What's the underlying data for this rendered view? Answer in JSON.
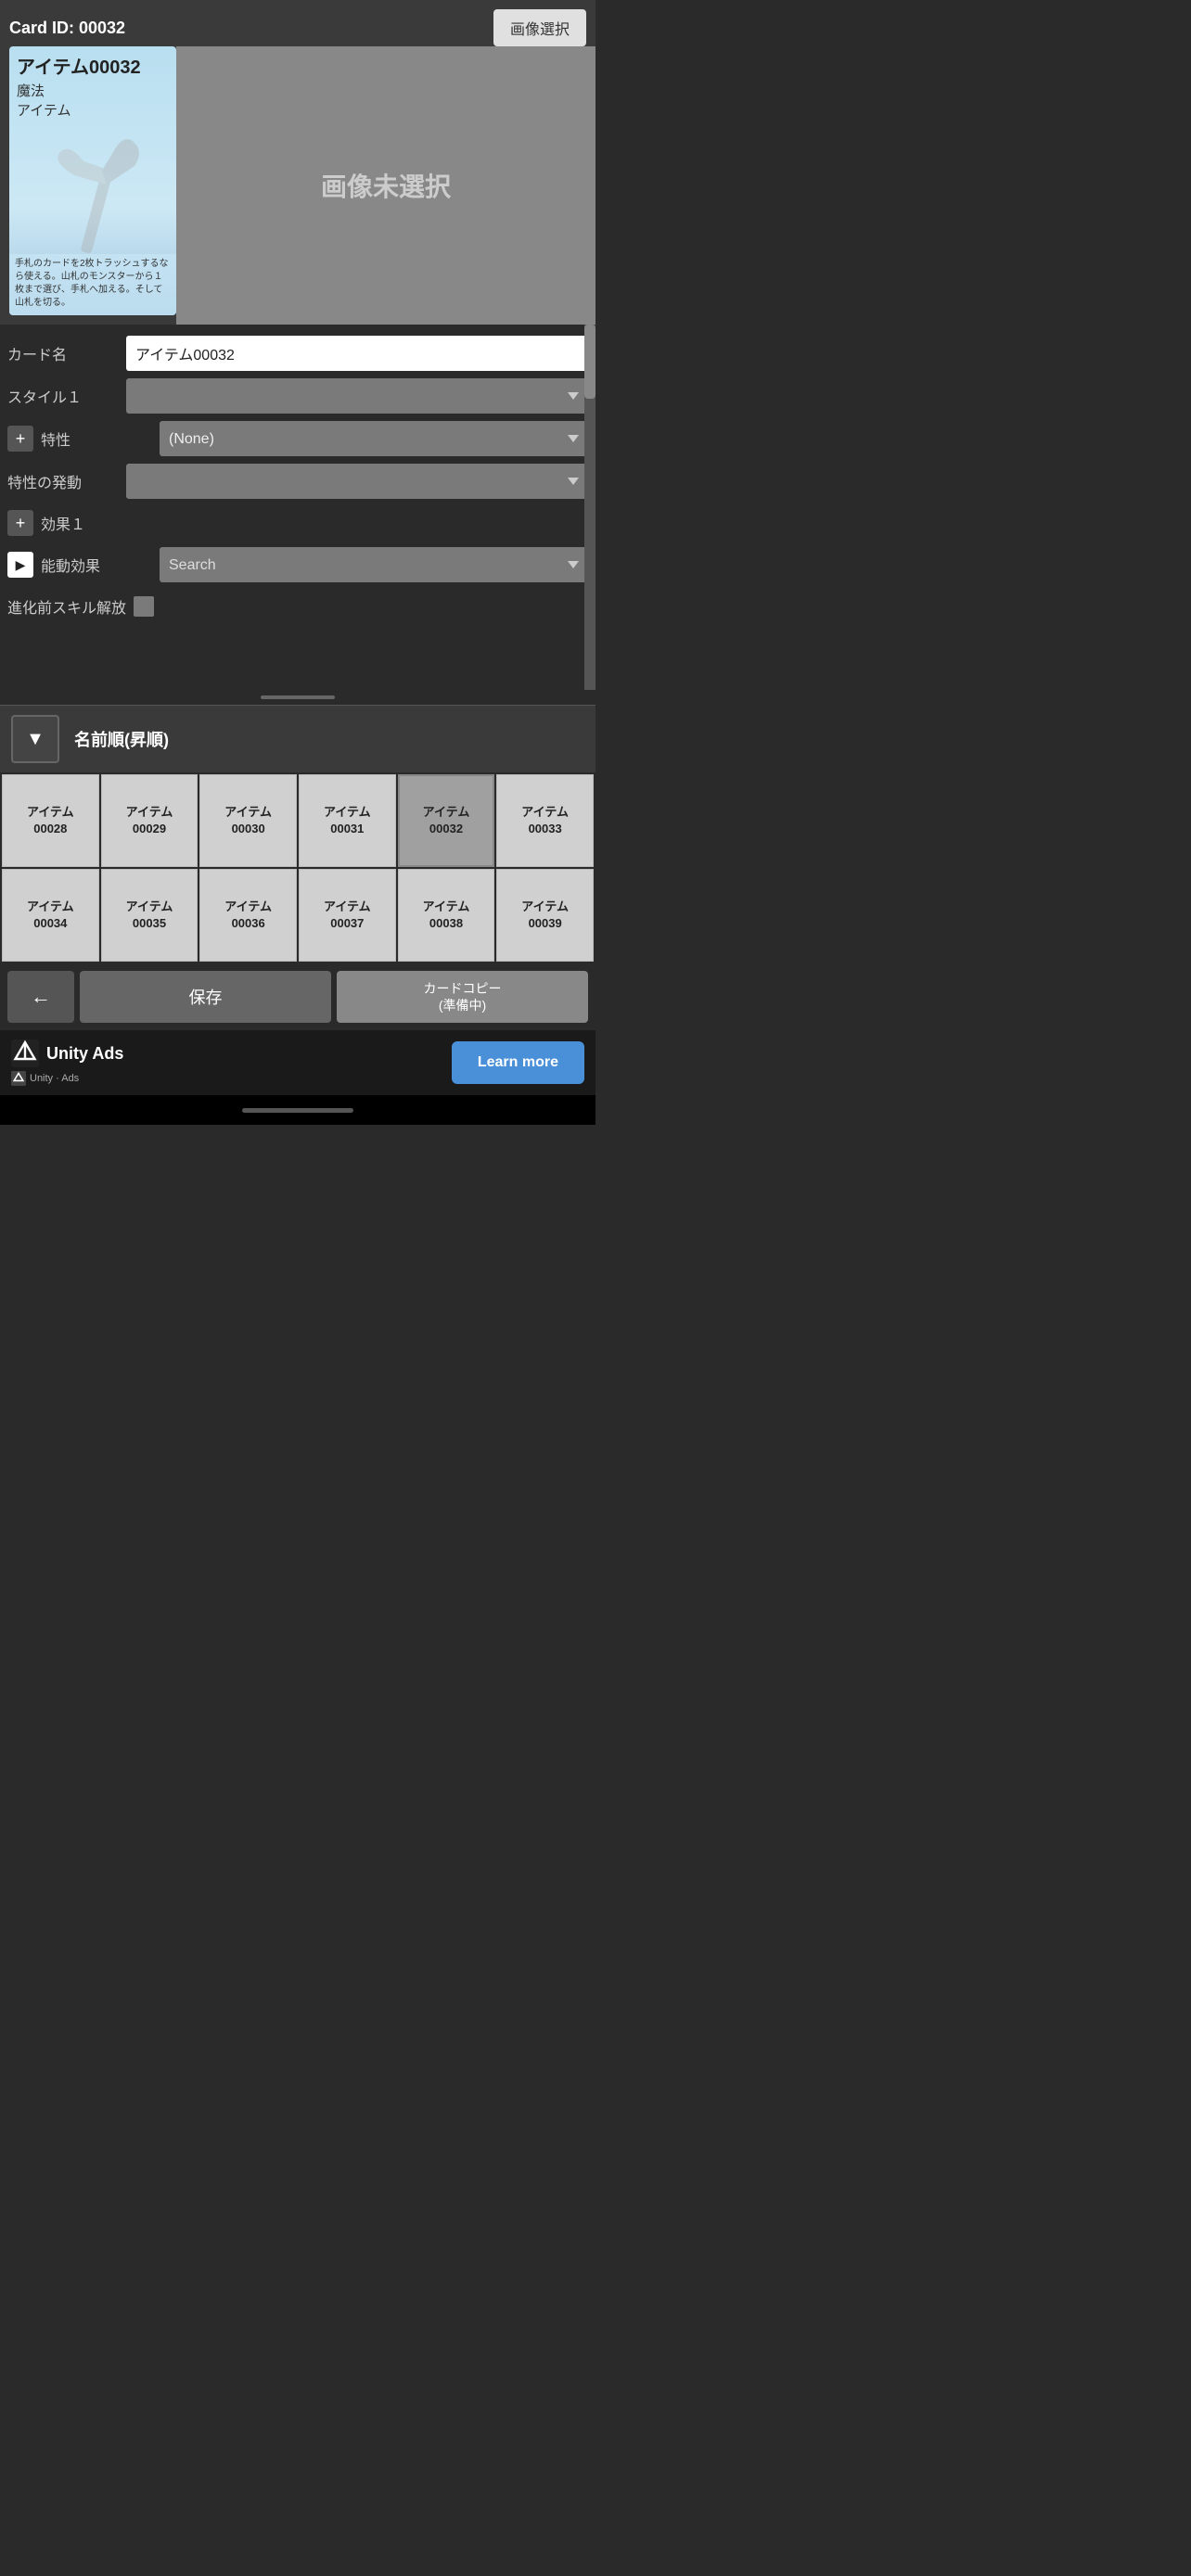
{
  "card": {
    "id": "Card ID: 00032",
    "title": "アイテム00032",
    "type1": "魔法",
    "type2": "アイテム",
    "description": "手札のカードを2枚トラッシュするなら使える。山札のモンスターから１枚まで選び、手札へ加える。そして山札を切る。",
    "no_image_text": "画像未選択"
  },
  "buttons": {
    "image_select": "画像選択",
    "sort": "▼",
    "sort_label": "名前順(昇順)",
    "back": "←",
    "save": "保存",
    "copy": "カードコピー\n(準備中)",
    "learn_more": "Learn more"
  },
  "form": {
    "card_name_label": "カード名",
    "card_name_value": "アイテム00032",
    "style1_label": "スタイル１",
    "trait_label": "特性",
    "trait_value": "(None)",
    "trait_trigger_label": "特性の発動",
    "effect1_label": "効果１",
    "active_effect_label": "能動効果",
    "active_effect_placeholder": "Search",
    "pre_evolve_label": "進化前スキル解放"
  },
  "grid": {
    "rows": [
      [
        {
          "label": "アイテム\n00028"
        },
        {
          "label": "アイテム\n00029"
        },
        {
          "label": "アイテム\n00030"
        },
        {
          "label": "アイテム\n00031"
        },
        {
          "label": "アイテム\n00032",
          "selected": true
        },
        {
          "label": "アイテム\n00033"
        }
      ],
      [
        {
          "label": "アイテム\n00034"
        },
        {
          "label": "アイテム\n00035"
        },
        {
          "label": "アイテム\n00036"
        },
        {
          "label": "アイテム\n00037"
        },
        {
          "label": "アイテム\n00038"
        },
        {
          "label": "アイテム\n00039"
        }
      ]
    ]
  },
  "ad": {
    "brand": "Unity Ads",
    "sub": "Unity · Ads",
    "learn_more": "Learn more"
  }
}
